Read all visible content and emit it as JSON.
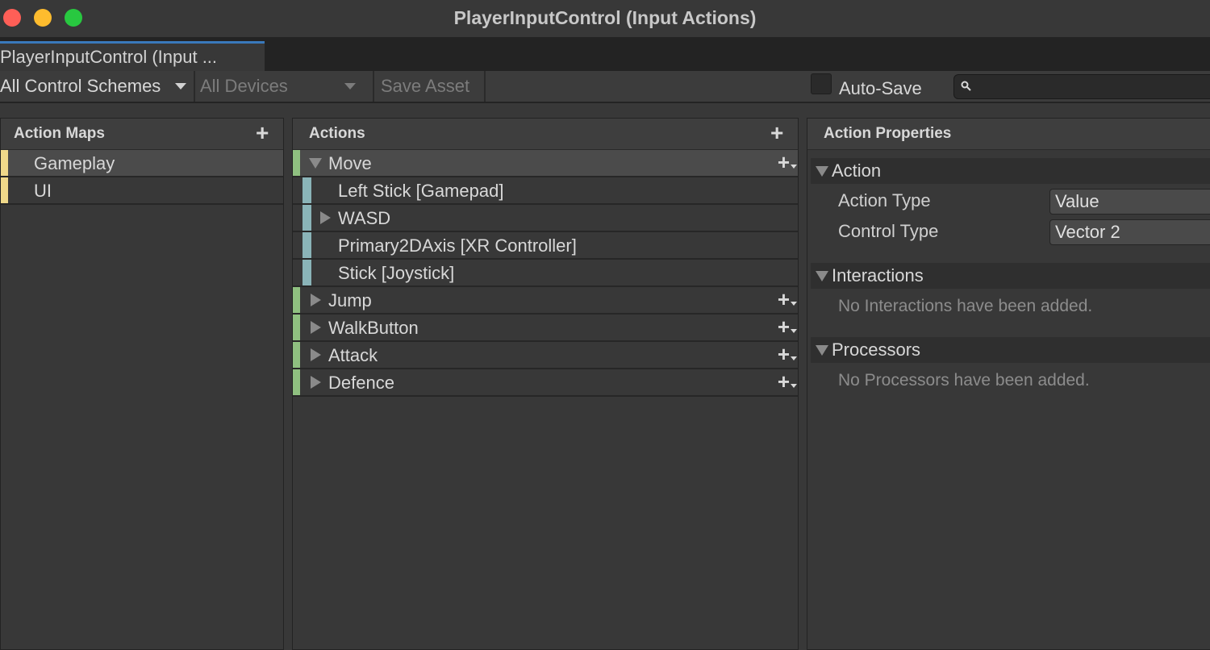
{
  "window": {
    "title": "PlayerInputControl (Input Actions)",
    "traffic_lights": {
      "close": "#fe5f57",
      "minimize": "#febc2e",
      "zoom": "#28c840"
    }
  },
  "tab": {
    "label": "PlayerInputControl (Input ..."
  },
  "toolbar": {
    "control_schemes": "All Control Schemes",
    "devices": "All Devices",
    "save_asset": "Save Asset",
    "auto_save_label": "Auto-Save",
    "auto_save_checked": false,
    "search_value": ""
  },
  "action_maps": {
    "title": "Action Maps",
    "items": [
      {
        "label": "Gameplay",
        "selected": true
      },
      {
        "label": "UI",
        "selected": false
      }
    ],
    "marker_color": "#f0d98a"
  },
  "actions": {
    "title": "Actions",
    "action_color": "#8fc080",
    "binding_color": "#8ab4b8",
    "items": [
      {
        "label": "Move",
        "kind": "action",
        "expanded": true,
        "selected": true
      },
      {
        "label": "Left Stick [Gamepad]",
        "kind": "binding"
      },
      {
        "label": "WASD",
        "kind": "composite",
        "expanded": false
      },
      {
        "label": "Primary2DAxis [XR Controller]",
        "kind": "binding"
      },
      {
        "label": "Stick [Joystick]",
        "kind": "binding"
      },
      {
        "label": "Jump",
        "kind": "action",
        "expanded": false
      },
      {
        "label": "WalkButton",
        "kind": "action",
        "expanded": false
      },
      {
        "label": "Attack",
        "kind": "action",
        "expanded": false
      },
      {
        "label": "Defence",
        "kind": "action",
        "expanded": false
      }
    ]
  },
  "properties": {
    "title": "Action Properties",
    "action_section": "Action",
    "action_type_label": "Action Type",
    "action_type_value": "Value",
    "control_type_label": "Control Type",
    "control_type_value": "Vector 2",
    "interactions_section": "Interactions",
    "interactions_empty": "No Interactions have been added.",
    "processors_section": "Processors",
    "processors_empty": "No Processors have been added."
  }
}
